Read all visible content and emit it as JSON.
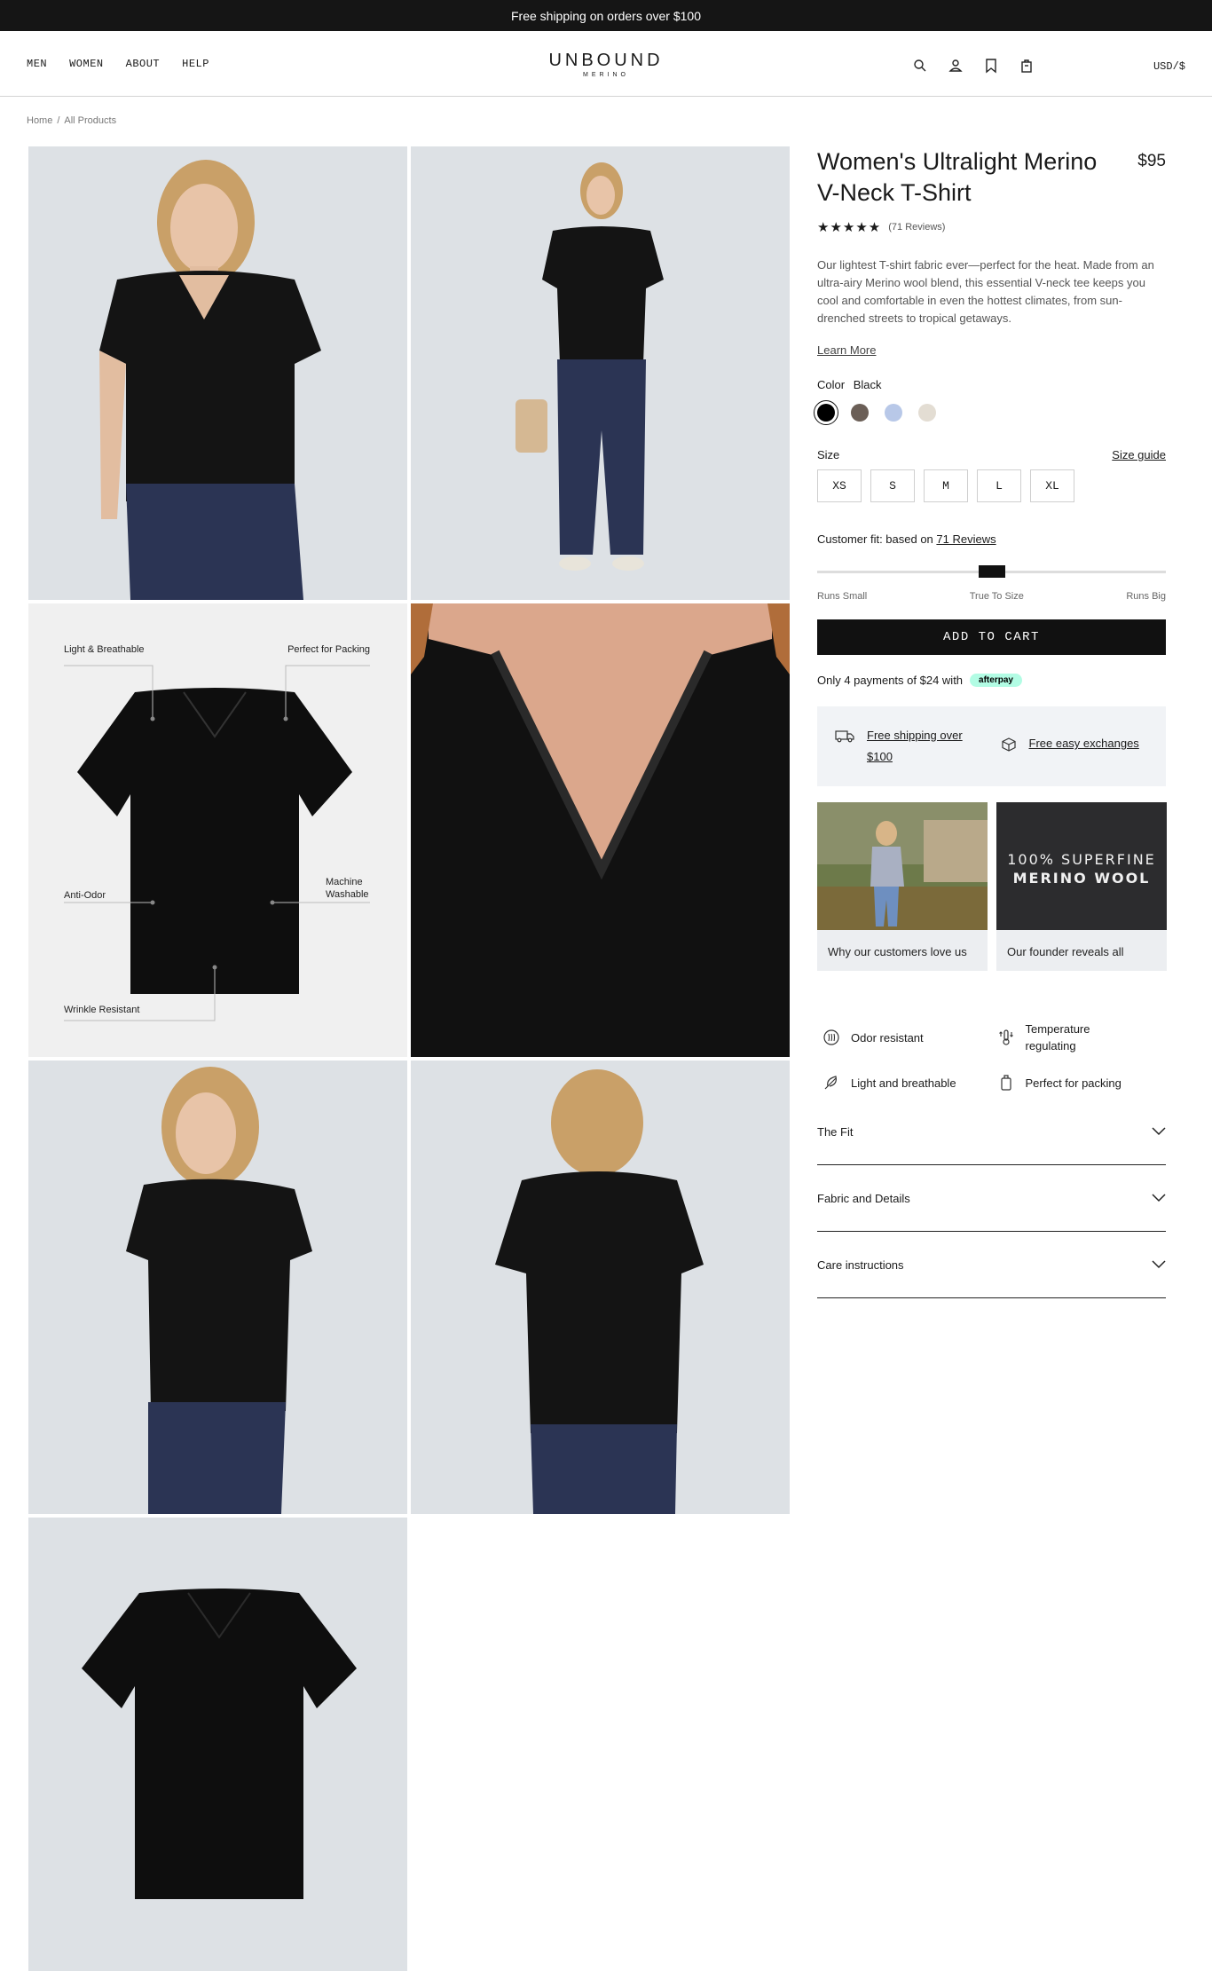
{
  "announcement": "Free shipping on orders over $100",
  "nav": [
    "MEN",
    "WOMEN",
    "ABOUT",
    "HELP"
  ],
  "logo": {
    "main": "UNBOUND",
    "sub": "MERINO"
  },
  "header_icons": [
    "search-icon",
    "account-icon",
    "bookmark-icon",
    "cart-icon"
  ],
  "currency": "USD/$",
  "breadcrumb": [
    "Home",
    "All Products"
  ],
  "gallery": {
    "callouts": {
      "light": "Light & Breathable",
      "packing": "Perfect for Packing",
      "odor": "Anti-Odor",
      "machine_line1": "Machine",
      "machine_line2": "Washable",
      "wrinkle": "Wrinkle Resistant"
    }
  },
  "product": {
    "title": "Women's Ultralight Merino V-Neck T-Shirt",
    "price": "$95",
    "rating": 5,
    "stars": "★★★★★",
    "review_count": "(71 Reviews)",
    "description": "Our lightest T-shirt fabric ever—perfect for the heat. Made from an ultra-airy Merino wool blend, this essential V-neck tee keeps you cool and comfortable in even the hottest climates, from sun-drenched streets to tropical getaways.",
    "learn_more": "Learn More",
    "color_label": "Color",
    "color_value": "Black",
    "colors": [
      "#000000",
      "#6b5f57",
      "#b8c8e8",
      "#e3ddd3"
    ],
    "size_label": "Size",
    "size_guide": "Size guide",
    "sizes": [
      "XS",
      "S",
      "M",
      "L",
      "XL"
    ],
    "fit_text": "Customer fit: based on",
    "fit_link": "71 Reviews",
    "fit_value": 0.5,
    "fit_labels": [
      "Runs Small",
      "True To Size",
      "Runs Big"
    ],
    "add_to_cart": "ADD TO CART",
    "afterpay_text": "Only 4 payments of $24 with",
    "afterpay_badge": "afterpay"
  },
  "shipping": [
    {
      "icon": "truck-icon",
      "label": "Free shipping over $100"
    },
    {
      "icon": "box-icon",
      "label": "Free easy exchanges"
    }
  ],
  "promos": [
    {
      "caption": "Why our customers love us"
    },
    {
      "caption": "Our founder reveals all",
      "image_text_line1": "100% SUPERFINE",
      "image_text_line2": "MERINO WOOL"
    }
  ],
  "features": [
    {
      "icon": "odor-resistant-icon",
      "label": "Odor resistant"
    },
    {
      "icon": "thermometer-icon",
      "label": "Temperature regulating"
    },
    {
      "icon": "feather-icon",
      "label": "Light and breathable"
    },
    {
      "icon": "luggage-icon",
      "label": "Perfect for packing"
    }
  ],
  "accordions": [
    "The Fit",
    "Fabric and Details",
    "Care instructions"
  ],
  "colors": {
    "dark": "#151515",
    "panel_bg": "#f1f3f6",
    "photo_bg": "#dde1e5",
    "afterpay_mint": "#b2fce4"
  }
}
